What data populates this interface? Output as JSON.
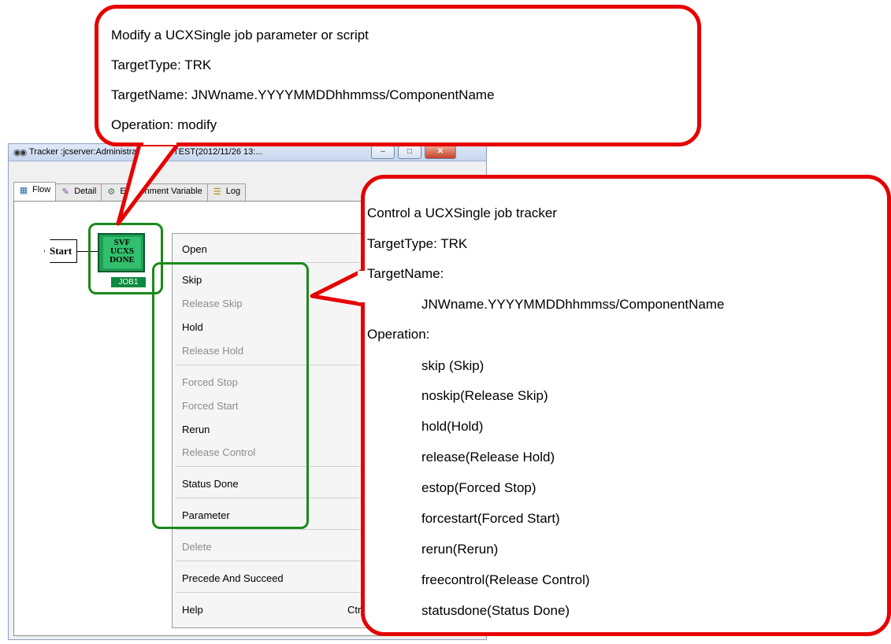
{
  "window": {
    "title": "Tracker :jcserver:Administrator:UCXSTEST(2012/11/26 13:...",
    "title_visible_left": "Tracker :jcserver:Adr",
    "title_visible_right": "r:UCXSTEST(2012/11/26 13:...",
    "buttons": {
      "minimize": "–",
      "maximize": "□",
      "close": "✕"
    }
  },
  "tabs": [
    {
      "label": "Flow",
      "icon": "flow-icon"
    },
    {
      "label": "Detail",
      "icon": "detail-icon"
    },
    {
      "label": "Environment Variable",
      "icon": "environment-variable-icon"
    },
    {
      "label": "Log",
      "icon": "log-icon"
    }
  ],
  "flow": {
    "start_label": "Start",
    "job_icon_lines": [
      "SVF",
      "UCXS",
      "DONE"
    ],
    "job_label": "JOB1"
  },
  "context_menu": {
    "items": [
      {
        "label": "Open",
        "enabled": true
      },
      {
        "label": "Skip",
        "enabled": true
      },
      {
        "label": "Release Skip",
        "enabled": false
      },
      {
        "label": "Hold",
        "enabled": true
      },
      {
        "label": "Release Hold",
        "enabled": false
      },
      {
        "label": "Forced Stop",
        "enabled": false
      },
      {
        "label": "Forced Start",
        "enabled": false
      },
      {
        "label": "Rerun",
        "enabled": true
      },
      {
        "label": "Release Control",
        "enabled": false
      },
      {
        "label": "Status Done",
        "enabled": true
      },
      {
        "label": "Parameter",
        "enabled": true
      },
      {
        "label": "Delete",
        "enabled": false
      },
      {
        "label": "Precede And Succeed",
        "enabled": true
      },
      {
        "label": "Help",
        "enabled": true,
        "shortcut": "Ctrl"
      }
    ]
  },
  "callout_top": {
    "lines": [
      "Modify a UCXSingle job parameter or script",
      "TargetType: TRK",
      "TargetName: JNWname.YYYYMMDDhhmmss/ComponentName",
      "Operation: modify"
    ]
  },
  "callout_right": {
    "lines": [
      "Control a UCXSingle job tracker",
      "TargetType: TRK",
      "TargetName:",
      "JNWname.YYYYMMDDhhmmss/ComponentName",
      "Operation:",
      "skip (Skip)",
      "noskip(Release Skip)",
      "hold(Hold)",
      "release(Release Hold)",
      "estop(Forced Stop)",
      "forcestart(Forced Start)",
      "rerun(Rerun)",
      "freecontrol(Release Control)",
      "statusdone(Status Done)"
    ]
  },
  "colors": {
    "callout_border": "#e60000",
    "highlight_border": "#1a8a1a",
    "job_icon": "#32c06e",
    "menu_disabled_text": "#8c8c8c"
  }
}
